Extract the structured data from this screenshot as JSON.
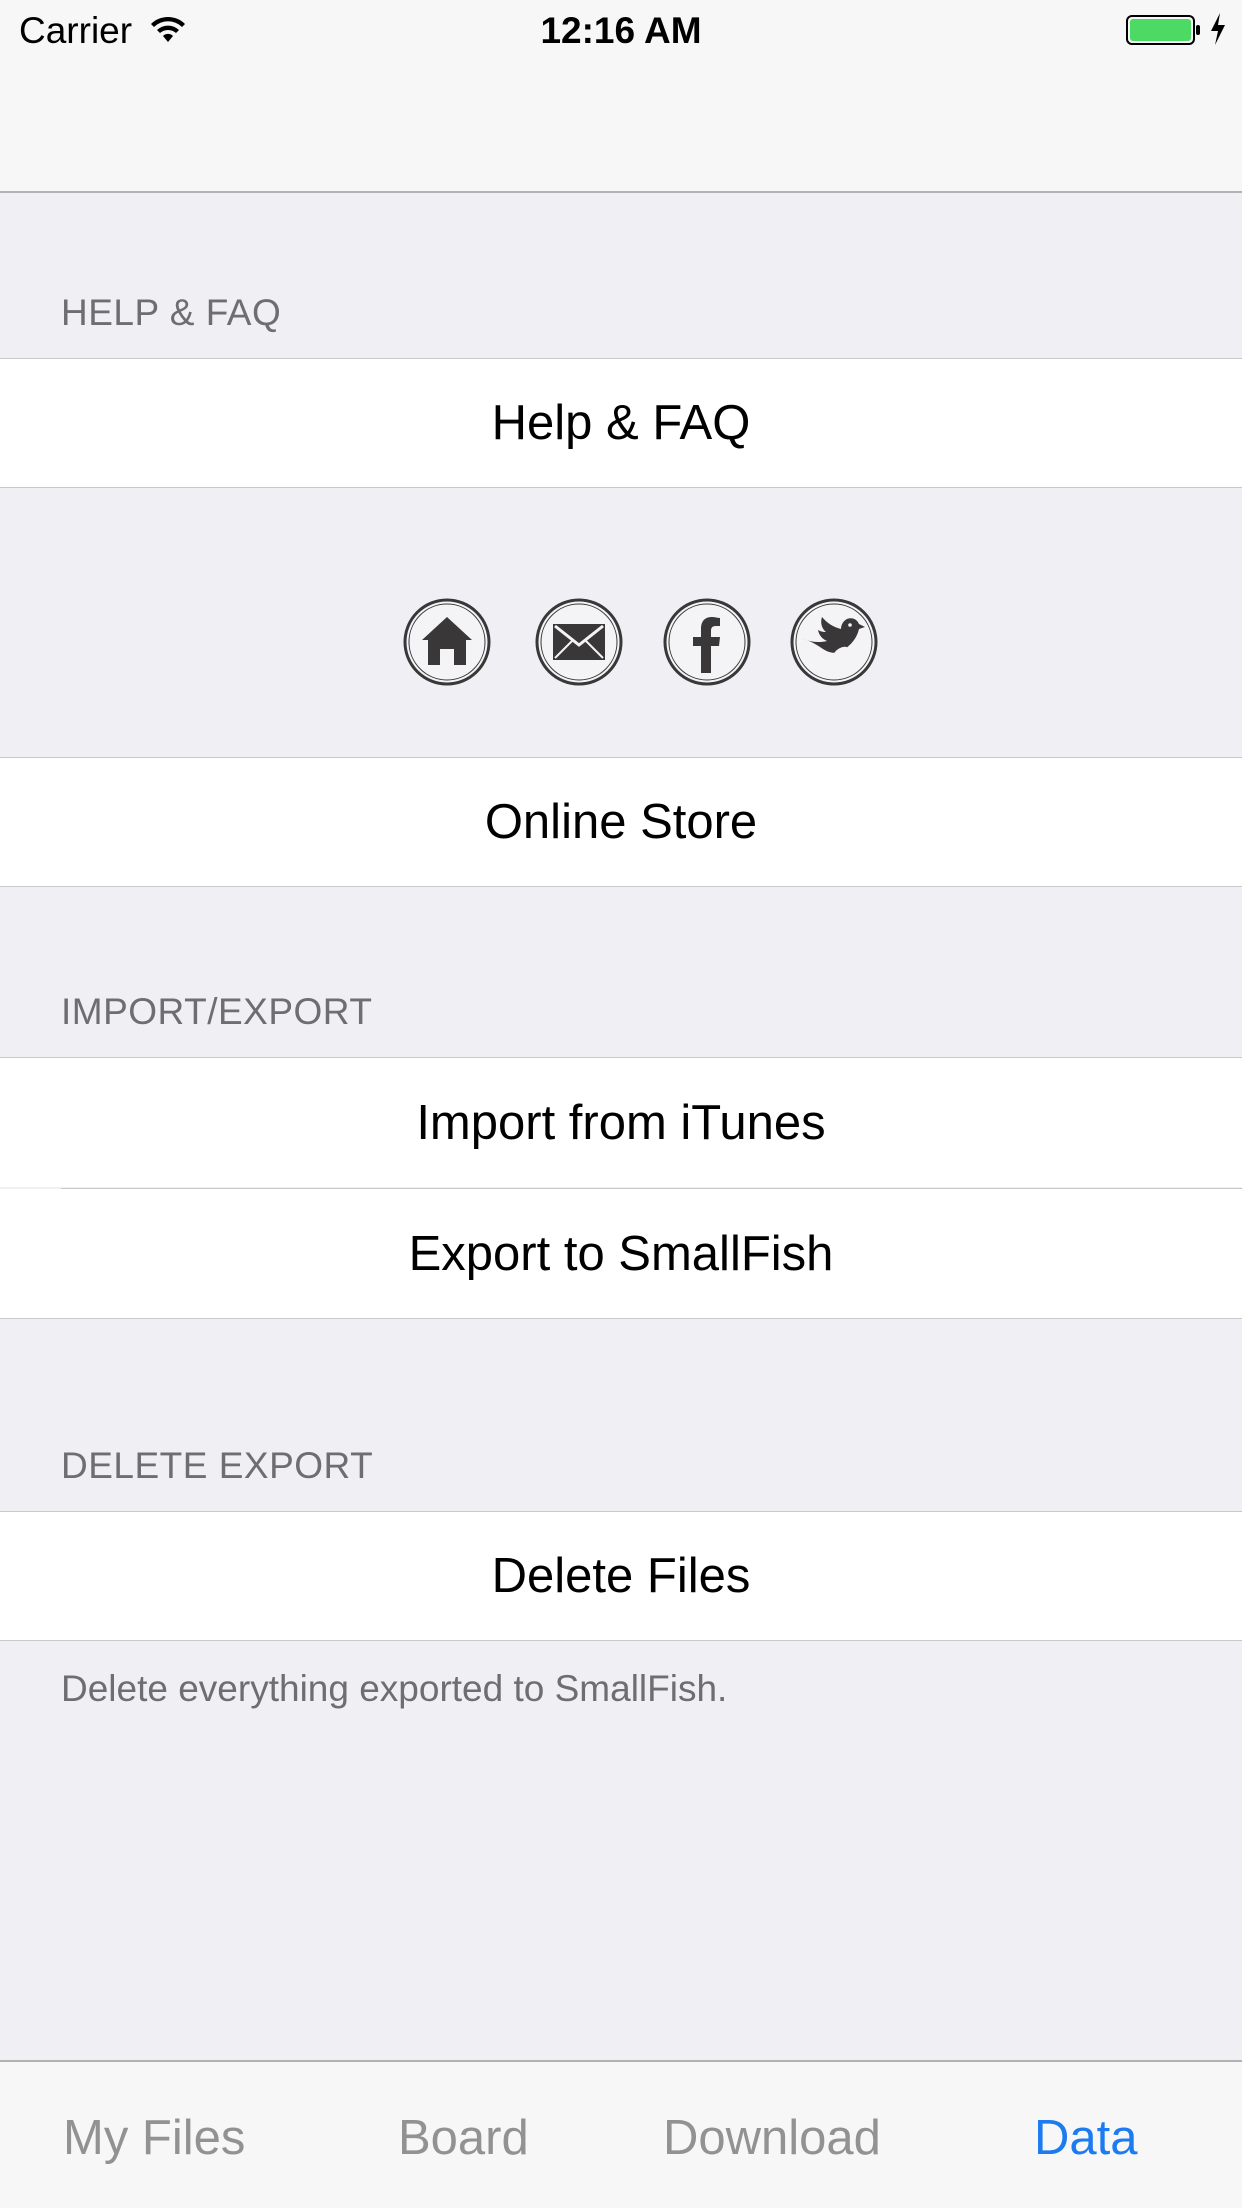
{
  "status_bar": {
    "carrier": "Carrier",
    "time": "12:16 AM",
    "wifi_icon": "wifi-icon",
    "battery_icon": "battery-icon",
    "battery_color": "#4cd964"
  },
  "sections": {
    "help": {
      "header": "HELP & FAQ",
      "cell_label": "Help & FAQ"
    },
    "social": {
      "icons": [
        "home-icon",
        "mail-icon",
        "facebook-icon",
        "twitter-bird-icon"
      ],
      "store_label": "Online Store"
    },
    "import_export": {
      "header": "IMPORT/EXPORT",
      "import_label": "Import from iTunes",
      "export_label": "Export to SmallFish"
    },
    "delete_export": {
      "header": "DELETE EXPORT",
      "delete_label": "Delete Files",
      "footer": "Delete everything exported to SmallFish."
    }
  },
  "tab_bar": {
    "tabs": [
      {
        "label": "My Files",
        "active": false
      },
      {
        "label": "Board",
        "active": false
      },
      {
        "label": "Download",
        "active": false
      },
      {
        "label": "Data",
        "active": true
      }
    ],
    "active_color": "#1c7bf0",
    "inactive_color": "#929292"
  }
}
